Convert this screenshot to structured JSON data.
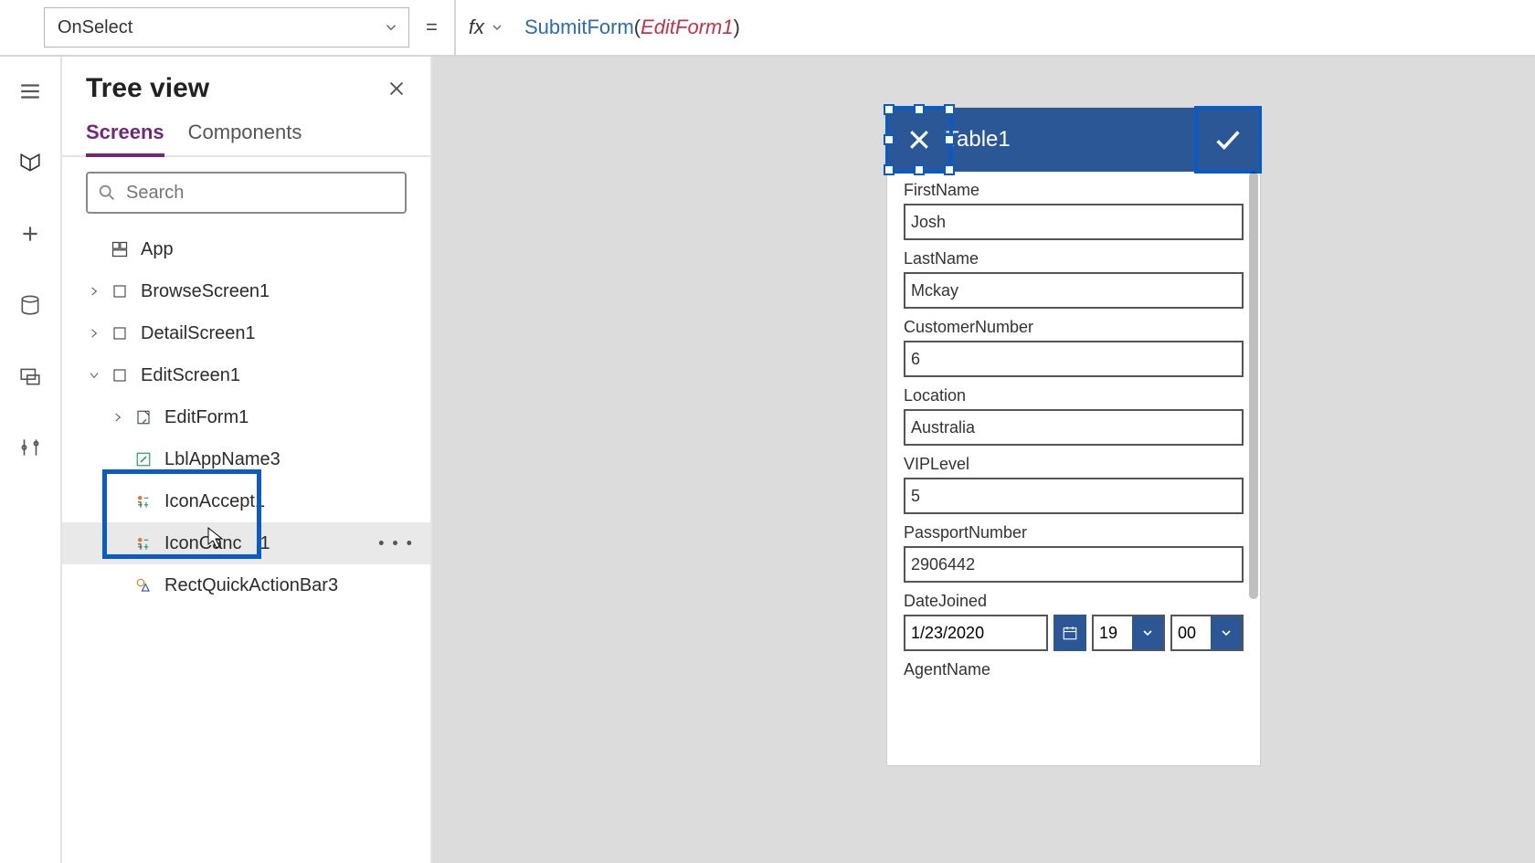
{
  "formula_bar": {
    "property": "OnSelect",
    "fx_label": "fx",
    "formula_fn": "SubmitForm",
    "formula_id": "EditForm1"
  },
  "tree_view": {
    "title": "Tree view",
    "tabs": {
      "screens": "Screens",
      "components": "Components"
    },
    "search_placeholder": "Search",
    "app_label": "App",
    "nodes": {
      "browse": "BrowseScreen1",
      "detail": "DetailScreen1",
      "edit": "EditScreen1",
      "editform": "EditForm1",
      "lblapp": "LblAppName3",
      "iconaccept": "IconAccept1",
      "iconcancel_partial": "IconCanc",
      "iconcancel_suffix": "1",
      "rect": "RectQuickActionBar3"
    }
  },
  "phone": {
    "title": "Table1",
    "fields": {
      "firstname": {
        "label": "FirstName",
        "value": "Josh"
      },
      "lastname": {
        "label": "LastName",
        "value": "Mckay"
      },
      "custnum": {
        "label": "CustomerNumber",
        "value": "6"
      },
      "location": {
        "label": "Location",
        "value": "Australia"
      },
      "vip": {
        "label": "VIPLevel",
        "value": "5"
      },
      "passport": {
        "label": "PassportNumber",
        "value": "2906442"
      },
      "datejoined": {
        "label": "DateJoined",
        "date": "1/23/2020",
        "hour": "19",
        "minute": "00"
      },
      "agent": {
        "label": "AgentName"
      }
    }
  }
}
